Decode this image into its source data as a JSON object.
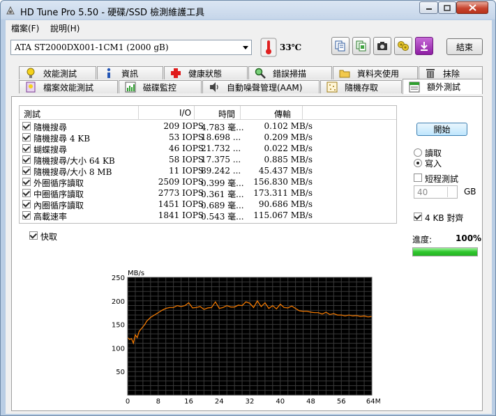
{
  "window": {
    "title": "HD Tune Pro 5.50 - 硬碟/SSD 檢測維護工具"
  },
  "menu": [
    "檔案(F)",
    "說明(H)"
  ],
  "toolbar": {
    "drive": "ATA    ST2000DX001-1CM1 (2000 gB)",
    "temperature": "33℃",
    "exit_label": "結束",
    "icons": [
      "copy-icon",
      "copy-info-icon",
      "camera-icon",
      "options-icon",
      "download-icon"
    ]
  },
  "tabs": {
    "row1": [
      {
        "label": "效能測試",
        "icon": "benchmark-icon"
      },
      {
        "label": "資訊",
        "icon": "info-icon"
      },
      {
        "label": "健康狀態",
        "icon": "health-icon"
      },
      {
        "label": "錯誤掃描",
        "icon": "scan-icon"
      },
      {
        "label": "資料夾使用",
        "icon": "folder-icon"
      },
      {
        "label": "抹除",
        "icon": "erase-icon"
      }
    ],
    "row2": [
      {
        "label": "檔案效能測試",
        "icon": "file-benchmark-icon"
      },
      {
        "label": "磁碟監控",
        "icon": "disk-monitor-icon"
      },
      {
        "label": "自動噪聲管理(AAM)",
        "icon": "speaker-icon"
      },
      {
        "label": "隨機存取",
        "icon": "random-access-icon"
      },
      {
        "label": "額外測試",
        "icon": "extra-tests-icon",
        "active": true
      }
    ]
  },
  "table": {
    "headers": {
      "test": "測試",
      "io": "I/O",
      "time": "時間",
      "transfer": "傳輸"
    },
    "rows": [
      {
        "name": "隨機搜尋",
        "io": "209 IOPS",
        "time": "4.783 毫...",
        "transfer": "0.102 MB/s"
      },
      {
        "name": "隨機搜尋 4 KB",
        "io": "53 IOPS",
        "time": "18.698 ...",
        "transfer": "0.209 MB/s"
      },
      {
        "name": "蝴蝶搜尋",
        "io": "46 IOPS",
        "time": "21.732 ...",
        "transfer": "0.022 MB/s"
      },
      {
        "name": "隨機搜尋/大小 64 KB",
        "io": "58 IOPS",
        "time": "17.375 ...",
        "transfer": "0.885 MB/s"
      },
      {
        "name": "隨機搜尋/大小 8 MB",
        "io": "11 IOPS",
        "time": "89.242 ...",
        "transfer": "45.437 MB/s"
      },
      {
        "name": "外圈循序讀取",
        "io": "2509 IOPS",
        "time": "0.399 毫...",
        "transfer": "156.830 MB/s"
      },
      {
        "name": "中圈循序讀取",
        "io": "2773 IOPS",
        "time": "0.361 毫...",
        "transfer": "173.311 MB/s"
      },
      {
        "name": "內圈循序讀取",
        "io": "1451 IOPS",
        "time": "0.689 毫...",
        "transfer": "90.686 MB/s"
      },
      {
        "name": "高載速率",
        "io": "1841 IOPS",
        "time": "0.543 毫...",
        "transfer": "115.067 MB/s"
      }
    ]
  },
  "cache_label": "快取",
  "side": {
    "start_label": "開始",
    "read_label": "讀取",
    "write_label": "寫入",
    "selected_mode": "寫入",
    "short_test_label": "短程測試",
    "short_test_value": "40",
    "short_test_unit": "GB",
    "align_label": "4 KB 對齊",
    "progress_label": "進度:",
    "progress_value": "100%",
    "progress_fraction": 1.0
  },
  "chart_data": {
    "type": "line",
    "ylabel": "MB/s",
    "xlabel": "MB",
    "xlim": [
      0,
      64
    ],
    "ylim": [
      0,
      250
    ],
    "xticks": [
      0,
      8,
      16,
      24,
      32,
      40,
      48,
      56,
      64
    ],
    "xtick_labels": [
      "0",
      "8",
      "16",
      "24",
      "32",
      "40",
      "48",
      "56",
      "64MB"
    ],
    "yticks": [
      50,
      100,
      150,
      200,
      250
    ],
    "series": [
      {
        "color": "#ff7f00",
        "x": [
          0,
          0.5,
          1,
          1.5,
          2,
          2.5,
          3,
          3.5,
          4,
          4.5,
          5,
          6,
          7,
          8,
          9,
          10,
          11,
          12,
          13,
          14,
          15,
          16,
          17,
          18,
          19,
          20,
          21,
          22,
          23,
          24,
          25,
          26,
          27,
          28,
          29,
          30,
          31,
          32,
          33,
          34,
          35,
          36,
          37,
          38,
          39,
          40,
          41,
          42,
          43,
          44,
          45,
          46,
          47,
          48,
          49,
          50,
          51,
          52,
          53,
          54,
          55,
          56,
          57,
          58,
          59,
          60,
          61,
          62,
          63,
          64
        ],
        "y": [
          122,
          118,
          120,
          110,
          128,
          122,
          135,
          140,
          145,
          150,
          157,
          165,
          170,
          175,
          180,
          184,
          186,
          186,
          190,
          188,
          190,
          196,
          185,
          186,
          188,
          182,
          185,
          186,
          198,
          184,
          186,
          190,
          187,
          187,
          191,
          190,
          198,
          195,
          186,
          200,
          188,
          196,
          184,
          190,
          183,
          193,
          186,
          185,
          189,
          184,
          179,
          178,
          178,
          176,
          175,
          175,
          172,
          176,
          171,
          173,
          170,
          170,
          168,
          170,
          168,
          169,
          167,
          168,
          166,
          167
        ]
      }
    ],
    "grid": true,
    "background": "#000000"
  }
}
